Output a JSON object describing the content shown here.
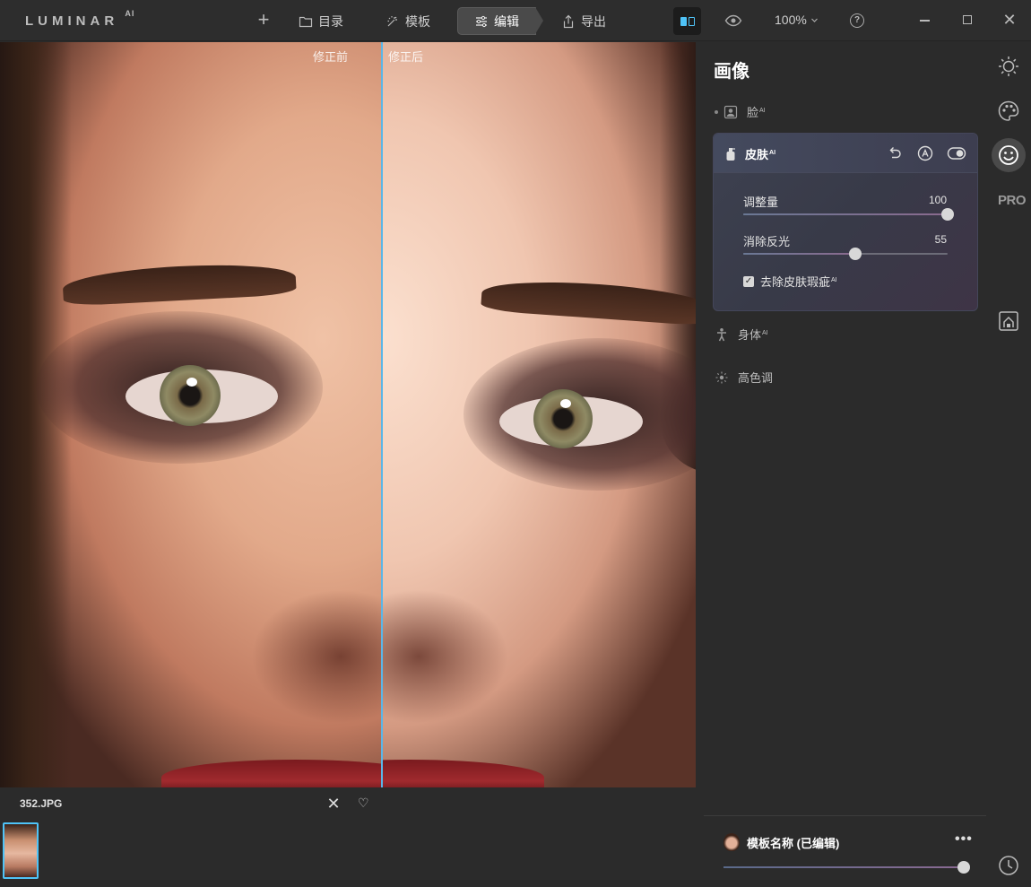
{
  "app": {
    "logo": "LUMINAR",
    "logo_suffix": "AI"
  },
  "toolbar": {
    "catalog": "目录",
    "templates": "模板",
    "edit": "编辑",
    "export": "导出",
    "zoom": "100%"
  },
  "canvas": {
    "before_label": "修正前",
    "after_label": "修正后"
  },
  "filmstrip": {
    "file_name": "352.JPG"
  },
  "panel": {
    "title": "画像",
    "face": {
      "label": "脸",
      "ai": "AI"
    },
    "skin": {
      "label": "皮肤",
      "ai": "AI",
      "amount_label": "调整量",
      "amount_value": "100",
      "amount_fraction": 1.0,
      "shine_label": "消除反光",
      "shine_value": "55",
      "shine_fraction": 0.55,
      "blemish_label": "去除皮肤瑕疵",
      "blemish_ai": "AI",
      "blemish_checked": true
    },
    "body": {
      "label": "身体",
      "ai": "AI"
    },
    "highkey": {
      "label": "高色调"
    },
    "preset": {
      "name": "模板名称 (已编辑)",
      "amount_fraction": 1.0
    }
  },
  "rail": {
    "pro": "PRO"
  },
  "colors": {
    "accent": "#4fc3f7",
    "panel_bg": "#2b2b2b"
  }
}
